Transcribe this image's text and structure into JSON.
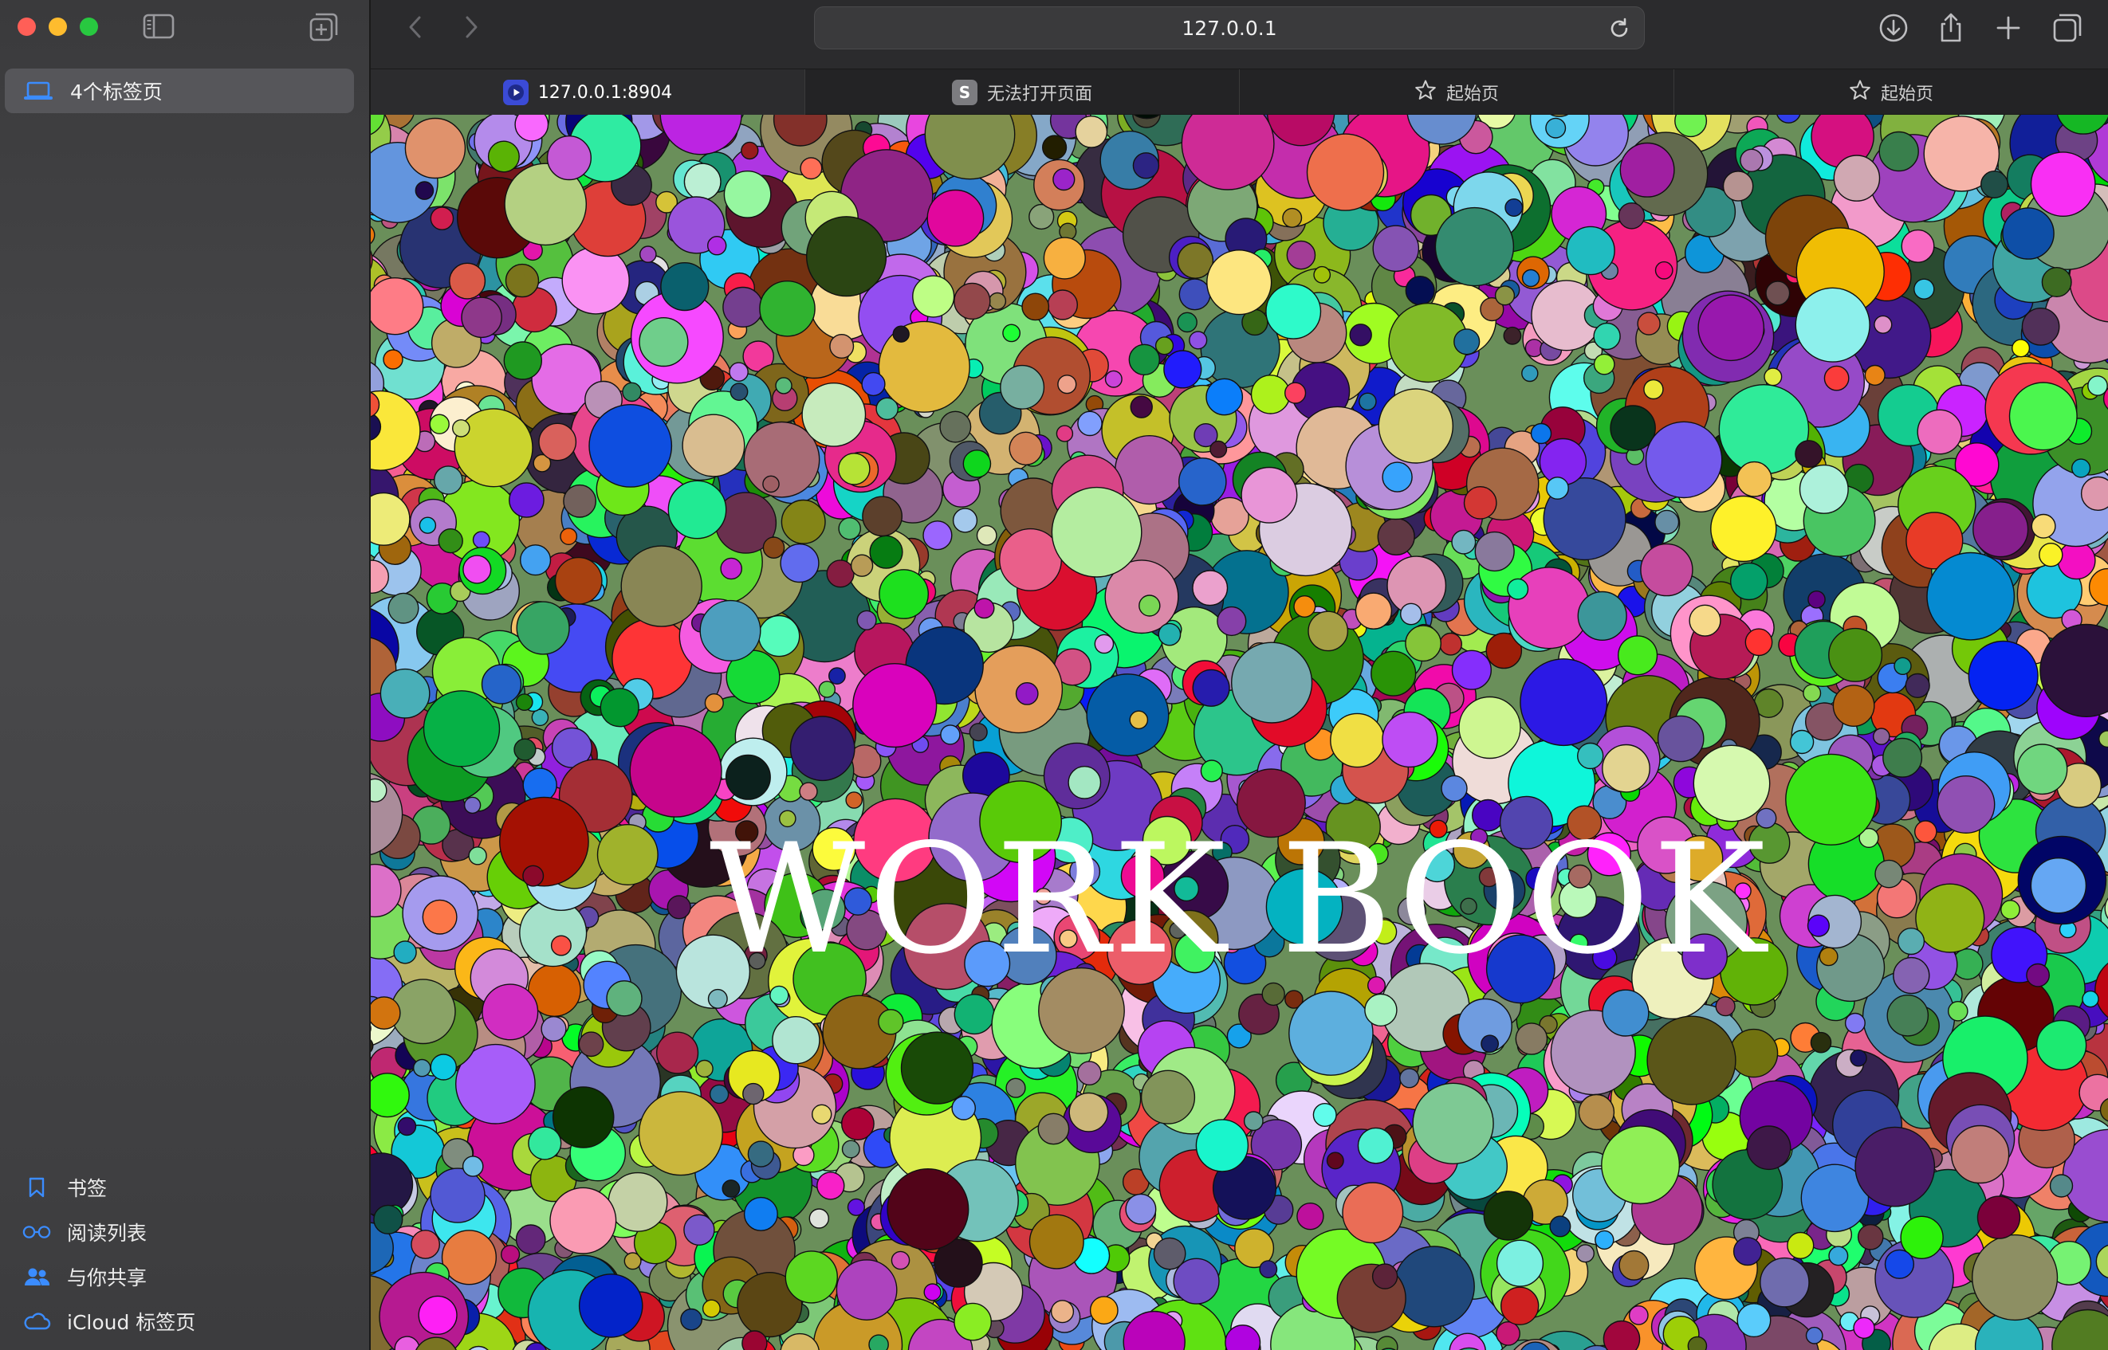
{
  "window": {
    "traffic_lights": [
      "close",
      "minimize",
      "zoom"
    ]
  },
  "sidebar": {
    "toggle_icon": "sidebar-icon",
    "new_tab_group_icon": "new-tab-group-icon",
    "tab_group": {
      "label": "4个标签页",
      "icon": "laptop-icon"
    },
    "bottom_links": [
      {
        "label": "书签",
        "icon": "bookmark-icon"
      },
      {
        "label": "阅读列表",
        "icon": "glasses-icon"
      },
      {
        "label": "与你共享",
        "icon": "people-icon"
      },
      {
        "label": "iCloud 标签页",
        "icon": "cloud-icon"
      }
    ]
  },
  "toolbar": {
    "address": "127.0.0.1",
    "icons": [
      "back-icon",
      "forward-icon",
      "reload-icon",
      "download-icon",
      "share-icon",
      "new-tab-icon",
      "tab-overview-icon"
    ]
  },
  "tabs": [
    {
      "label": "127.0.0.1:8904",
      "active": true,
      "favicon": "play-icon",
      "favicon_color": "#3b4bd6"
    },
    {
      "label": "无法打开页面",
      "active": false,
      "favicon": "S",
      "favicon_color": "#7c7c80"
    },
    {
      "label": "起始页",
      "active": false,
      "favicon": "star-icon"
    },
    {
      "label": "起始页",
      "active": false,
      "favicon": "star-icon"
    }
  ],
  "page": {
    "title": "WORK BOOK",
    "background": "random colored circles"
  },
  "colors": {
    "accent_blue": "#0a84ff",
    "sidebar_icon_blue": "#3b8cff"
  }
}
